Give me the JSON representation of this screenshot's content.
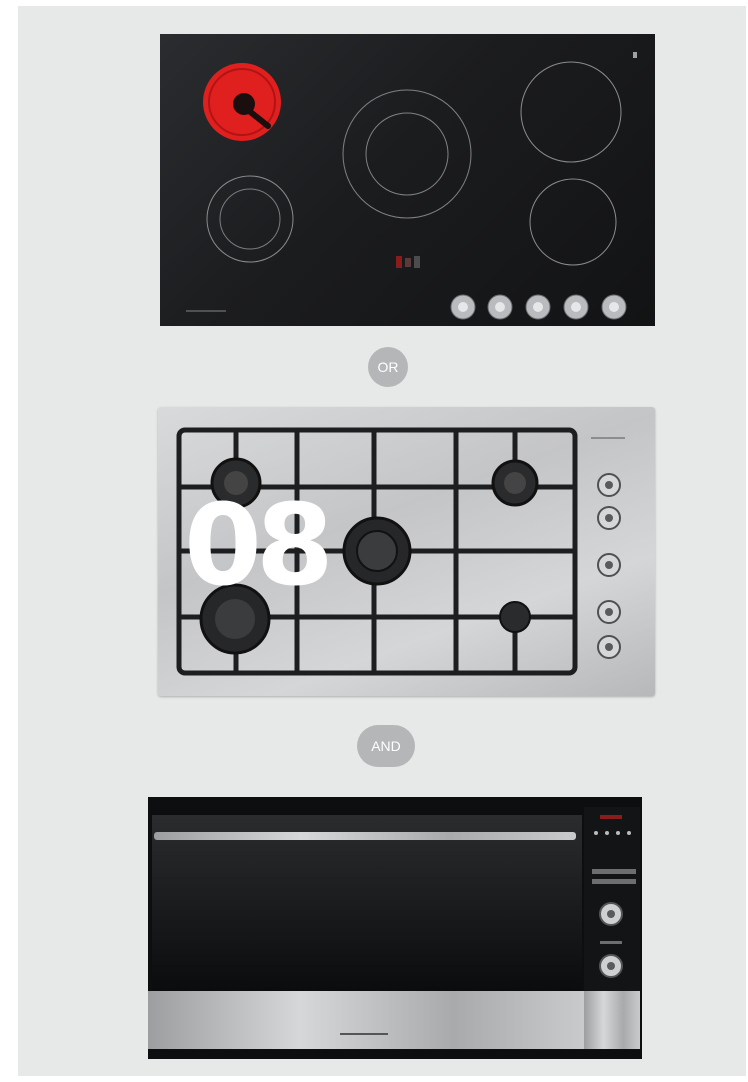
{
  "page": {
    "background": "#e7e8e8"
  },
  "separators": {
    "or_label": "OR",
    "and_label": "AND"
  },
  "overlay": {
    "number": "08"
  },
  "colors": {
    "hot_zone": "#e01f1f",
    "pill": "#b5b6b7",
    "ceramic_surface": "#1b1c1e",
    "steel": "#c7c8ca"
  },
  "icons": {
    "knob": "knob-icon",
    "burner": "gas-burner-icon",
    "zone": "cooking-zone-icon"
  }
}
